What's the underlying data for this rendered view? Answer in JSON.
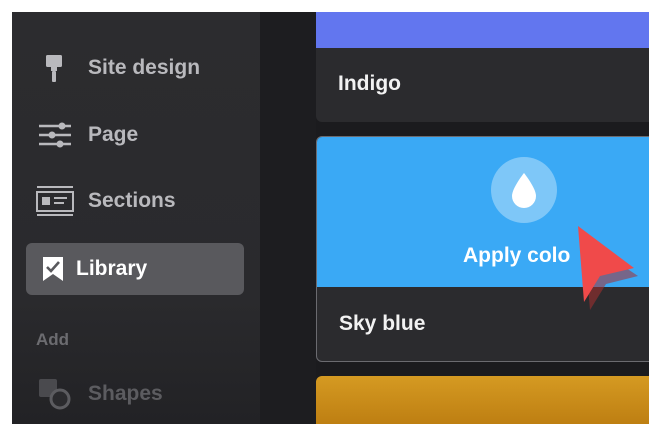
{
  "sidebar": {
    "items": [
      {
        "label": "Site design",
        "icon": "paint-roller-icon"
      },
      {
        "label": "Page",
        "icon": "sliders-icon"
      },
      {
        "label": "Sections",
        "icon": "section-layout-icon"
      },
      {
        "label": "Library",
        "icon": "bookmark-check-icon",
        "active": true
      }
    ],
    "add_section": {
      "label": "Add",
      "items": [
        {
          "label": "Shapes",
          "icon": "shapes-icon"
        }
      ]
    }
  },
  "colors": [
    {
      "name": "Indigo",
      "hex": "#6276ef"
    },
    {
      "name": "Sky blue",
      "hex": "#3aa9f5",
      "hovered": true,
      "overlay_label": "Apply colo",
      "overlay_icon": "water-drop-icon"
    },
    {
      "name": "",
      "hex": "#d59a22"
    }
  ],
  "cursor": {
    "icon": "pointer-cursor-icon",
    "color": "#f04a4a"
  }
}
